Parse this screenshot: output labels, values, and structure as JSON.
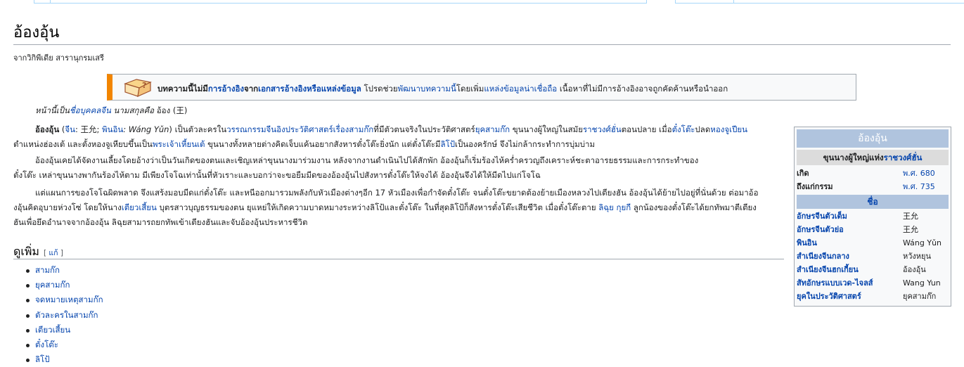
{
  "page": {
    "title": "อ้องอุ้น",
    "tagline": "จากวิกิพีเดีย สารานุกรมเสรี"
  },
  "ambox": {
    "text_1": "บทความนี้ไม่มี",
    "link_1": "การอ้างอิง",
    "text_2": "จาก",
    "link_2": "เอกสารอ้างอิงหรือแหล่งข้อมูล",
    "text_3": " โปรดช่วย",
    "link_3": "พัฒนาบทความนี้",
    "text_4": "โดยเพิ่ม",
    "link_4": "แหล่งข้อมูลน่าเชื่อถือ",
    "text_5": " เนื้อหาที่ไม่มีการอ้างอิงอาจถูกคัดค้านหรือนำออก",
    "icon": "book-question-icon"
  },
  "hatnote": {
    "pre": "หน้านี้เป็น",
    "link": "ชื่อบุคคลจีน",
    "mid": " นามสกุลคือ ",
    "surname": "อ้อง (王)"
  },
  "article": {
    "p1": {
      "bold": "อ้องอุ้น",
      "paren_open": " (",
      "link_zh": "จีน",
      "zh": ": 王允; ",
      "link_pinyin": "พินอิน",
      "pinyin": ": Wáng Yǔn",
      "paren_close": ") เป็นตัวละครใน",
      "link_novel": "วรรณกรรมจีนอิงประวัติศาสตร์เรื่องสามก๊ก",
      "t1": "ที่มีตัวตนจริงในประวัติศาสตร์",
      "link_era": "ยุคสามก๊ก",
      "t2": " ขุนนางผู้ใหญ่ในสมัย",
      "link_han": "ราชวงศ์ฮั่น",
      "t3": "ตอนปลาย เมื่อ",
      "link_dongzhuo": "ตั๋งโต๊ะ",
      "t4": "ปลด",
      "link_shaodi": "หองจูเปียน",
      "line2a": "ตำแหน่งฮ่องเต้ และตั้งหองจูเหียบขึ้นเป็น",
      "link_xiandi": "พระเจ้าเหี้ยนเต้",
      "line2b": " ขุนนางทั้งหลายต่างคิดเจ็บแค้นอยากสังหารตั๋งโต๊ะยิ่งนัก แต่ตั๋งโต๊ะมี",
      "link_lubu": "ลิโป้",
      "line2c": "เป็นองครักษ์ จึงไม่กล้ากระทำการบุ่มบ่าม"
    },
    "p2": {
      "line1": "อ้องอุ้นเคยได้จัดงานเลี้ยงโดยอ้างว่าเป็นวันเกิดของตนและเชิญเหล่าขุนนางมาร่วมงาน หลังจากงานดำเนินไปได้สักพัก อ้องอุ้นก็เริ่มร้องไห้คร่ำครวญถึงเคราะห์ชะตาอารยธรรมและการกระทำของ",
      "line2": "ตั๋งโต๊ะ เหล่าขุนนางพากันร้องไห้ตาม มีเพียงโจโฉเท่านั้นที่หัวเราะและบอกว่าจะขอยืมมีดของอ้องอุ้นไปสังหารตั๋งโต๊ะให้จงได้ อ้องอุ้นจึงได้ให้มีดไปแก่โจโฉ"
    },
    "p3": {
      "line1": "แต่แผนการของโจโฉผิดพลาด จึงแสร้งมอบมีดแก่ตั๋งโต๊ะ และหนีออกมารวมพลังกับหัวเมืองต่างๆอีก 17 หัวเมืองเพื่อกำจัดตั๋งโต๊ะ จนตั๋งโต๊ะขยาดต้องย้ายเมืองหลวงไปเตียงฮัน อ้องอุ้นได้ย้ายไปอยู่ที่นั่นด้วย ต่อมาอ้อ",
      "line2a": "งอุ้นคิดอุบายห่วงโซ่ โดยให้นาง",
      "link_diaochan": "เตียวเสี้ยน",
      "line2b": " บุตรสาวบุญธรรมของตน ยุแหย่ให้เกิดความบาดหมางระหว่างลิโป้และตั๋งโต๊ะ ในที่สุดลิโป้ก็สังหารตั๋งโต๊ะเสียชีวิต เมื่อตั๋งโต๊ะตาย ",
      "link_lijue": "ลิฉุย",
      "space": " ",
      "link_guosi": "กุยกี",
      "line2c": " ลูกน้องของตั๋งโต๊ะได้ยกทัพมาตีเตียง",
      "line3": "ฮันเพื่อยึดอำนาจจากอ้องอุ้น ลิฉุยสามารถยกทัพเข้าเตียงฮันและจับอ้องอุ้นประหารชีวิต"
    }
  },
  "see_also": {
    "heading": "ดูเพิ่ม",
    "edit_open": "[ ",
    "edit": "แก้",
    "edit_close": " ]",
    "items": [
      "สามก๊ก",
      "ยุคสามก๊ก",
      "จดหมายเหตุสามก๊ก",
      "ตัวละครในสามก๊ก",
      "เตียวเสี้ยน",
      "ตั๋งโต๊ะ",
      "ลิโป้"
    ]
  },
  "infobox": {
    "title": "อ้องอุ้น",
    "subtitle_text": "ขุนนางผู้ใหญ่แห่ง",
    "subtitle_link": "ราชวงศ์ฮั่น",
    "born_label": "เกิด",
    "born_value": "พ.ศ. 680",
    "died_label": "ถึงแก่กรรม",
    "died_value": "พ.ศ. 735",
    "names_header": "ชื่อ",
    "names": [
      {
        "label": "อักษรจีนตัวเต็ม",
        "value": "王允"
      },
      {
        "label": "อักษรจีนตัวย่อ",
        "value": "王允"
      },
      {
        "label": "พินอิน",
        "value": "Wáng Yǔn"
      },
      {
        "label": "สำเนียงจีนกลาง",
        "value": "หวังหยุน"
      },
      {
        "label": "สำเนียงจีนฮกเกี้ยน",
        "value": "อ้องอุ้น"
      },
      {
        "label": "สัทอักษรแบบเวด-ไจลส์",
        "value": "Wang Yun"
      },
      {
        "label": "ยุคในประวัติศาสตร์",
        "value": "ยุคสามก๊ก"
      }
    ],
    "colors": {
      "title_bg": "#b0c4de",
      "subtitle_bg": "#dcdcdc"
    }
  }
}
